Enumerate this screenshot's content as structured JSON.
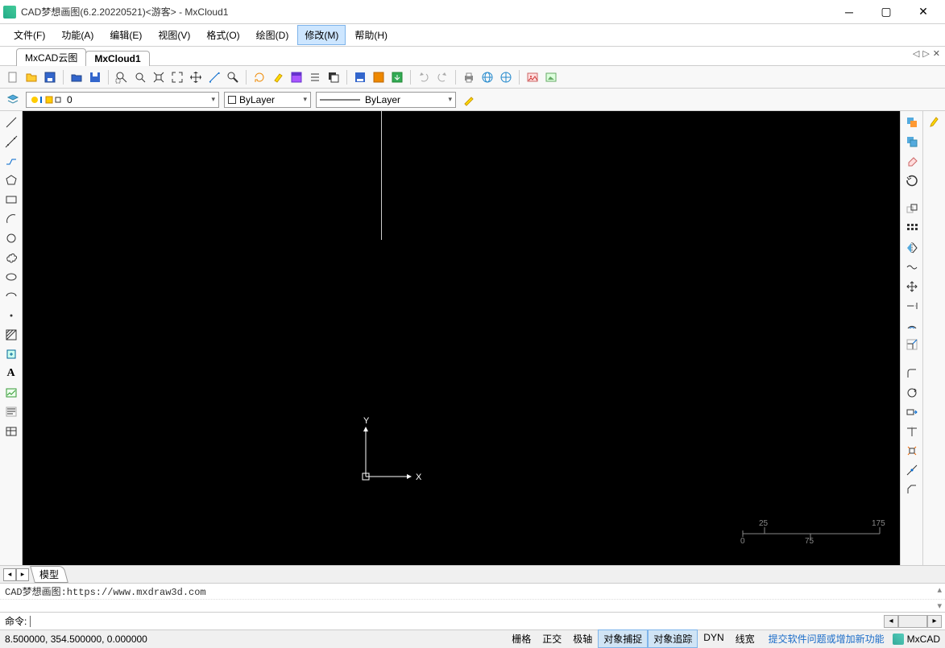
{
  "title": "CAD梦想画图(6.2.20220521)<游客> - MxCloud1",
  "menus": [
    "文件(F)",
    "功能(A)",
    "编辑(E)",
    "视图(V)",
    "格式(O)",
    "绘图(D)",
    "修改(M)",
    "帮助(H)"
  ],
  "active_menu_index": 6,
  "tabs": {
    "items": [
      "MxCAD云图",
      "MxCloud1"
    ],
    "active": 1
  },
  "layer": {
    "name": "0",
    "color_label": "ByLayer",
    "linetype_label": "ByLayer"
  },
  "model_tab": "模型",
  "cmd_history": "CAD梦想画图:https://www.mxdraw3d.com",
  "cmd_prompt": "命令:",
  "cmd_input": "",
  "coords": "8.500000, 354.500000, 0.000000",
  "status_toggles": [
    {
      "label": "栅格",
      "on": false
    },
    {
      "label": "正交",
      "on": false
    },
    {
      "label": "极轴",
      "on": false
    },
    {
      "label": "对象捕捉",
      "on": true
    },
    {
      "label": "对象追踪",
      "on": true
    },
    {
      "label": "DYN",
      "on": false
    },
    {
      "label": "线宽",
      "on": false
    }
  ],
  "feedback": "提交软件问题或增加新功能",
  "brand": "MxCAD",
  "axes": {
    "x": "X",
    "y": "Y"
  },
  "scale": {
    "a": "0",
    "b": "25",
    "c": "75",
    "d": "175"
  }
}
